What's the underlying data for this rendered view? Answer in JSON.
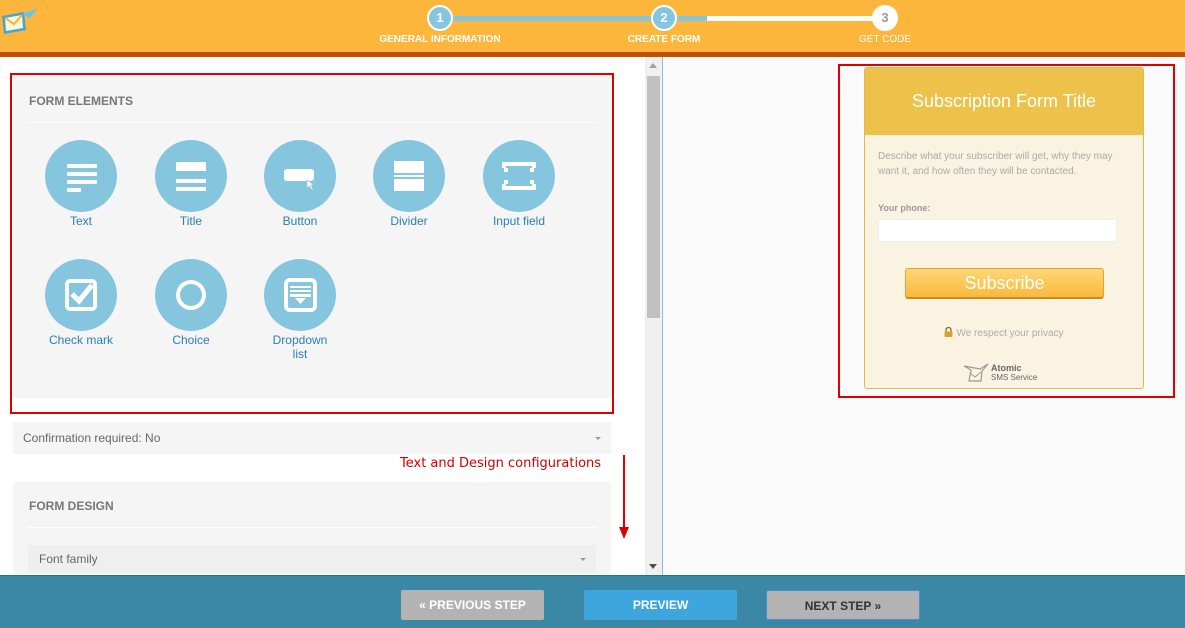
{
  "header": {
    "steps": [
      {
        "number": "1",
        "label": "GENERAL INFORMATION",
        "state": "complete"
      },
      {
        "number": "2",
        "label": "CREATE FORM",
        "state": "active"
      },
      {
        "number": "3",
        "label": "GET CODE",
        "state": "inactive"
      }
    ],
    "progress_fraction": 0.6
  },
  "form_elements": {
    "title": "FORM ELEMENTS",
    "items": [
      {
        "label": "Text",
        "icon": "text-lines-icon"
      },
      {
        "label": "Title",
        "icon": "title-icon"
      },
      {
        "label": "Button",
        "icon": "button-cursor-icon"
      },
      {
        "label": "Divider",
        "icon": "divider-icon"
      },
      {
        "label": "Input field",
        "icon": "input-field-icon"
      },
      {
        "label": "Check mark",
        "icon": "checkbox-icon"
      },
      {
        "label": "Choice",
        "icon": "radio-circle-icon"
      },
      {
        "label": "Dropdown list",
        "icon": "dropdown-list-icon"
      }
    ]
  },
  "confirmation": {
    "label": "Confirmation required: No"
  },
  "annotation": {
    "text": "Text and Design configurations"
  },
  "form_design": {
    "title": "FORM DESIGN",
    "font_family_placeholder": "Font family"
  },
  "preview": {
    "title": "Subscription Form Title",
    "description": "Describe what your subscriber will get, why they may want it, and how often they will be contacted.",
    "phone_label": "Your phone:",
    "phone_value": "",
    "subscribe_label": "Subscribe",
    "privacy_text": "We respect your privacy",
    "brand_line1": "Atomic",
    "brand_line2": "SMS Service"
  },
  "footer": {
    "prev_label": "« PREVIOUS STEP",
    "preview_label": "PREVIEW",
    "next_label": "NEXT STEP »"
  },
  "colors": {
    "header_bg": "#fdb63c",
    "header_border": "#c44e00",
    "step_blue": "#86c5de",
    "element_blue": "#86c5de",
    "footer_bg": "#3a87a6",
    "preview_button": "#3ea6dd",
    "form_header": "#eec24a",
    "annotation_red": "#e00000"
  }
}
